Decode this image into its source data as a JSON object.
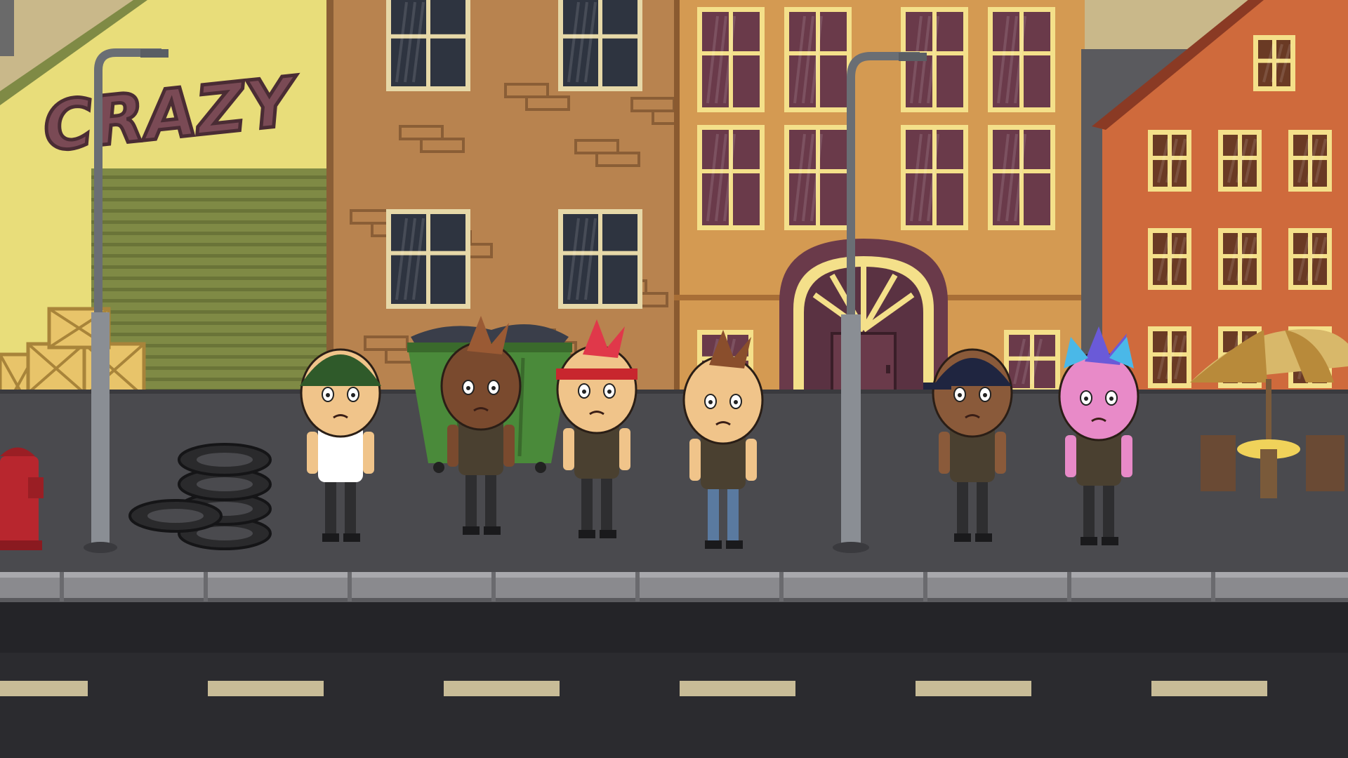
{
  "scene": {
    "type": "side-scrolling street level",
    "graffiti_text": "CRAZY",
    "colors": {
      "sky": "#c9b88a",
      "warehouse_wall": "#e8dd7a",
      "shutter": "#7f8a45",
      "brick_building": "#b8834f",
      "yellow_building": "#d49a52",
      "orange_building": "#cf6a3c",
      "sidewalk": "#4a4a4e",
      "curb": "#8a8a8e",
      "road": "#2b2b2f",
      "lane_marking": "#c8bc97",
      "window_frame": "#f4e08a"
    }
  },
  "characters": [
    {
      "id": "beanie-kid",
      "name_icon": "beanie-kid-icon",
      "hat_color": "#2f5a2a",
      "hair_color": "#7a4a2a",
      "shirt_color": "#ffffff"
    },
    {
      "id": "goggles-punk",
      "name_icon": "mohawk-goggles-icon",
      "skin_color": "#7a4a2e",
      "hair_color": "#9a5a34"
    },
    {
      "id": "headband-punk",
      "name_icon": "red-mohawk-icon",
      "hair_color": "#e0384a",
      "band_color": "#c8262e"
    },
    {
      "id": "scared-kid",
      "name_icon": "brown-hair-kid-icon",
      "hair_color": "#8a4e2c",
      "pants_color": "#5a7aa0"
    },
    {
      "id": "cap-kid",
      "name_icon": "cap-kid-icon",
      "cap_color": "#1f2540",
      "skin_color": "#8a5a3a"
    },
    {
      "id": "cat-ear-girl",
      "name_icon": "cat-ear-headphones-icon",
      "skin_color": "#e88ac8",
      "hair_color": "#6a5ad8",
      "ear_color": "#4ab8e8"
    }
  ]
}
